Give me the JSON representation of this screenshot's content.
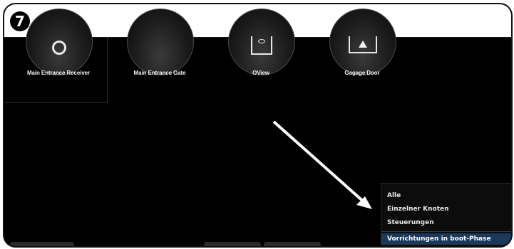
{
  "step": "7",
  "devices": [
    {
      "label": "Main Entrance Receiver",
      "icon": "receiver-icon"
    },
    {
      "label": "Main Entrance Gate",
      "icon": "gate-icon"
    },
    {
      "label": "OView",
      "icon": "oview-icon"
    },
    {
      "label": "Gagage Door",
      "icon": "garage-door-icon"
    }
  ],
  "context_menu": {
    "items": [
      {
        "label": "Alle"
      },
      {
        "label": "Einzelner Knoten"
      },
      {
        "label": "Steuerungen"
      },
      {
        "label": "Vorrichtungen in boot-Phase"
      }
    ]
  }
}
